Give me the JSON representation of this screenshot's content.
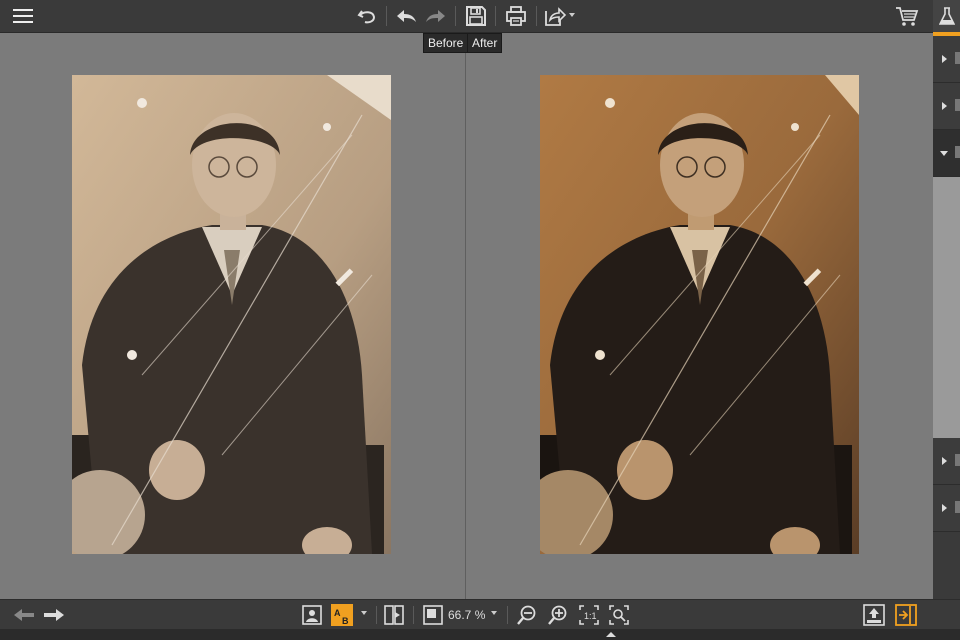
{
  "toolbar": {
    "menu_icon": "hamburger-icon",
    "tooltip_before": "Before",
    "tooltip_after": "After",
    "cart_icon": "shopping-cart-icon"
  },
  "bottom": {
    "zoom_value": "66.7 %"
  },
  "colors": {
    "accent": "#f0a020",
    "toolbar_bg": "#3a3a3a",
    "canvas_bg": "#7b7b7b"
  }
}
